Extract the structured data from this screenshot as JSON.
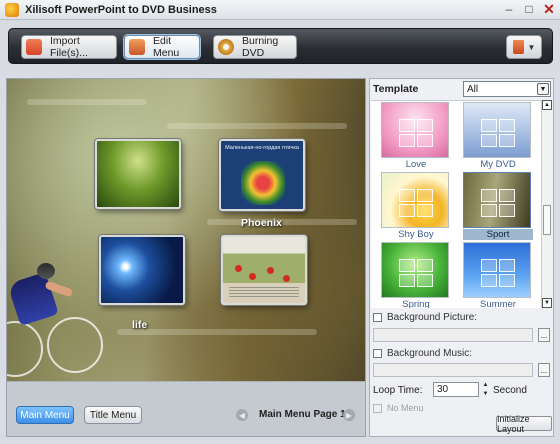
{
  "window": {
    "title": "Xilisoft PowerPoint to DVD Business"
  },
  "toolbar": {
    "import_label": "Import File(s)...",
    "edit_label": "Edit Menu",
    "burn_label": "Burning DVD"
  },
  "preview": {
    "thumbnails": [
      {
        "label": ""
      },
      {
        "label": "Phoenix",
        "slide_text": "Маленькая-но-гордая птичка"
      },
      {
        "label": "life"
      },
      {
        "label": ""
      }
    ],
    "footer": {
      "main_menu_label": "Main Menu",
      "title_menu_label": "Title Menu",
      "page_label": "Main Menu Page 1/1"
    }
  },
  "template_panel": {
    "heading": "Template",
    "filter_value": "All",
    "items": [
      {
        "name": "Love",
        "selected": false
      },
      {
        "name": "My DVD",
        "selected": false
      },
      {
        "name": "Shy Boy",
        "selected": false
      },
      {
        "name": "Sport",
        "selected": true
      },
      {
        "name": "Spring",
        "selected": false
      },
      {
        "name": "Summer",
        "selected": false
      }
    ],
    "background_picture_label": "Background Picture:",
    "background_picture_value": "",
    "background_music_label": "Background Music:",
    "background_music_value": "",
    "browse_label": "...",
    "loop_time_label": "Loop Time:",
    "loop_time_value": "30",
    "second_label": "Second",
    "no_menu_label": "No Menu",
    "initialize_label": "Initialize Layout"
  }
}
